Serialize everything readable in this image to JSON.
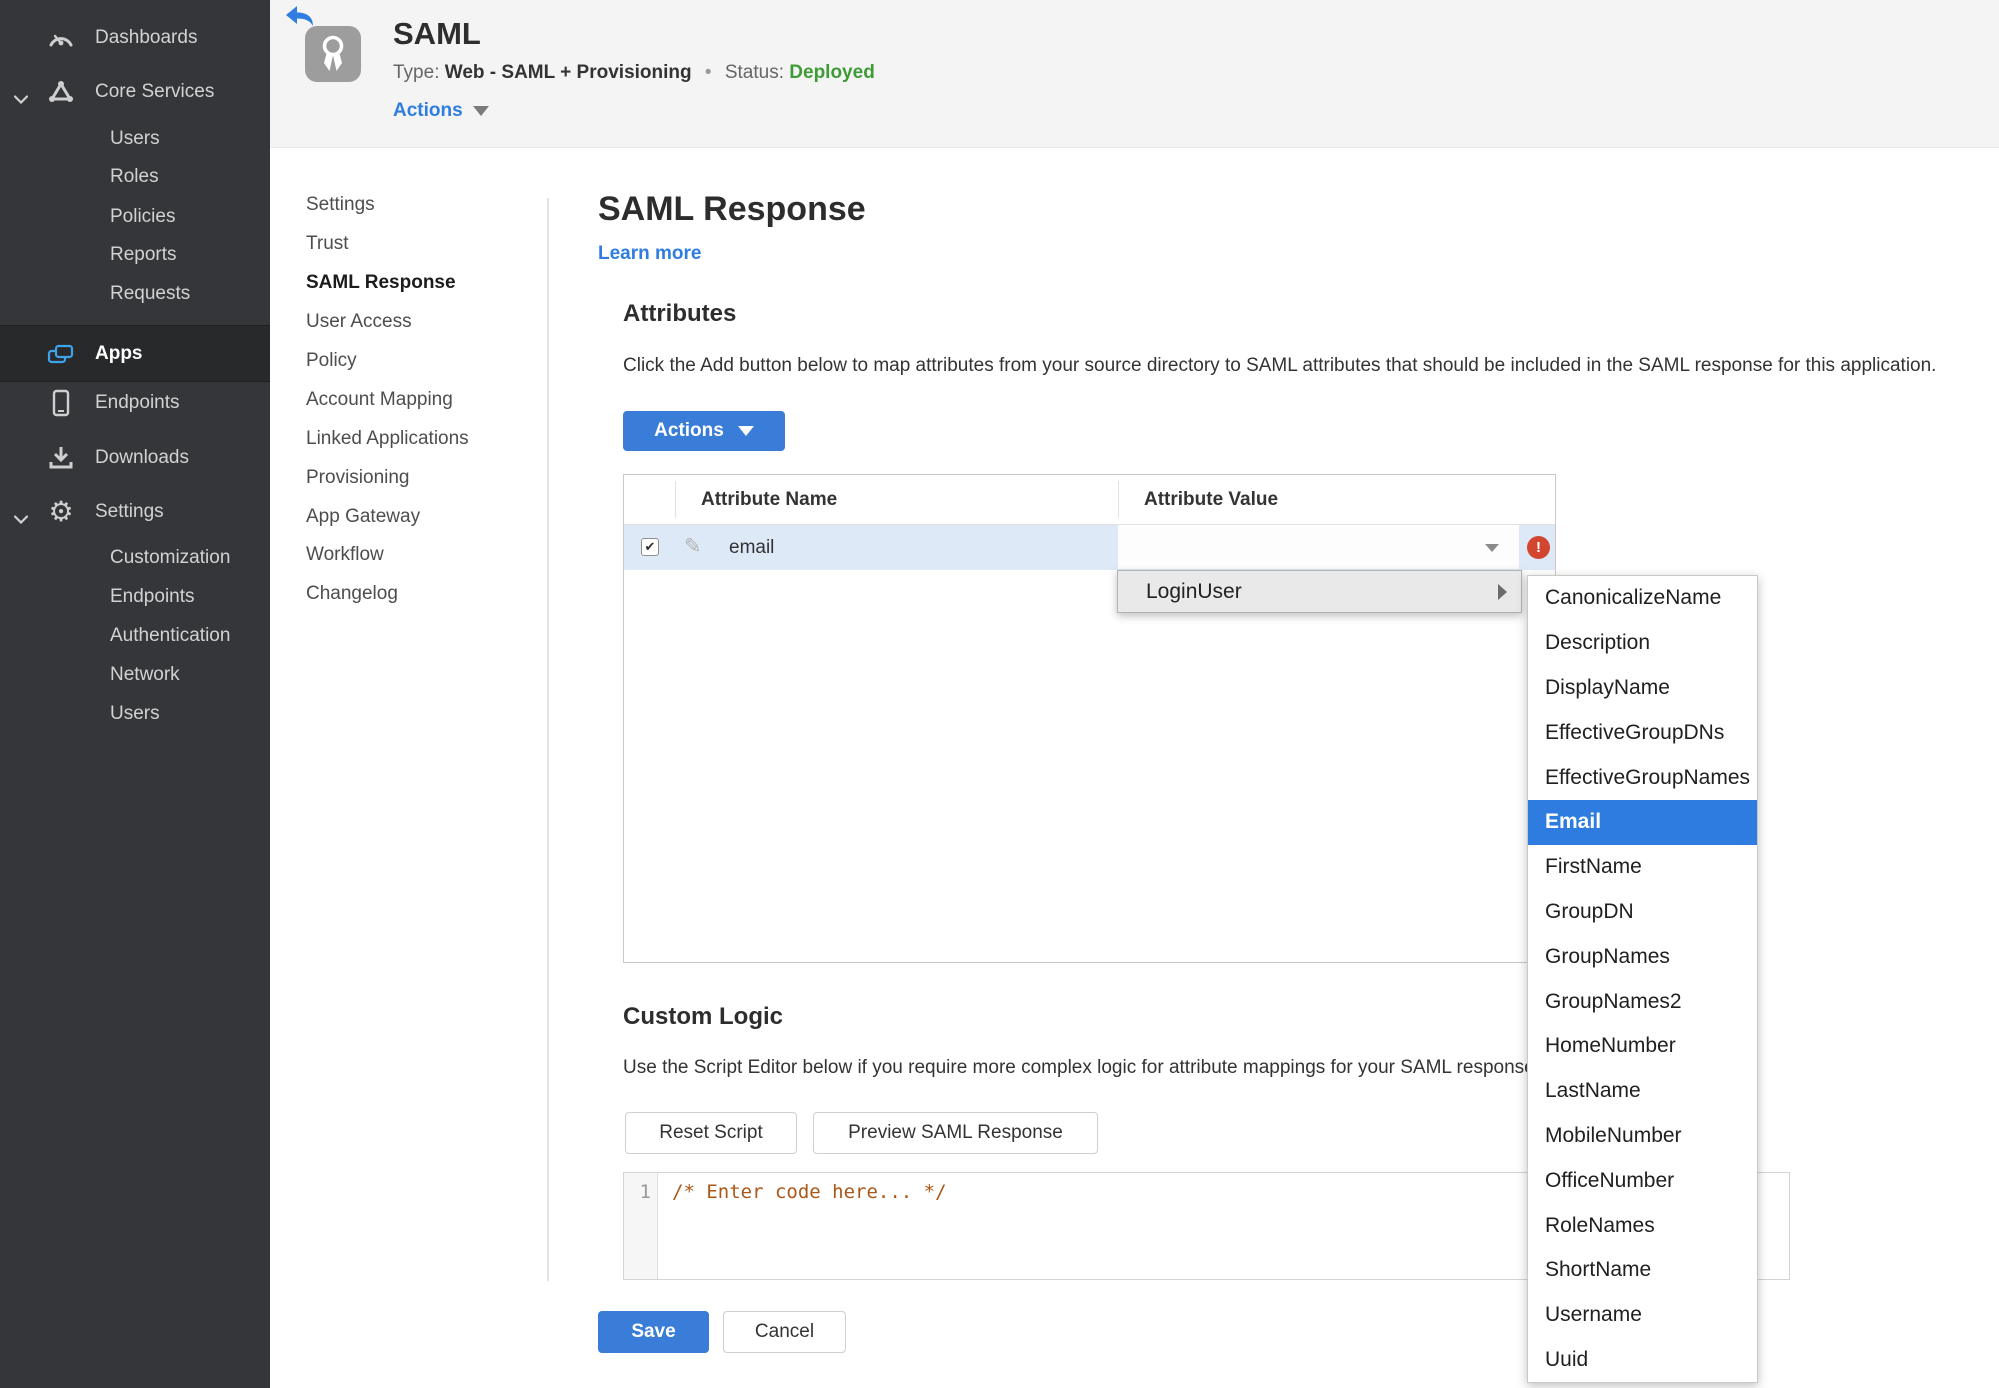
{
  "colors": {
    "accent_blue": "#2f7de1",
    "button_blue": "#3a7dd8",
    "status_green": "#3e9b35",
    "error_red": "#d2462f",
    "selection_blue": "#2e7ce0",
    "row_highlight": "#dde9f7",
    "sidebar_bg": "#343639"
  },
  "sidebar": {
    "items": [
      {
        "label": "Dashboards",
        "icon": "gauge-icon"
      },
      {
        "label": "Core Services",
        "icon": "core-services-icon",
        "expanded": true
      },
      {
        "label": "Users"
      },
      {
        "label": "Roles"
      },
      {
        "label": "Policies"
      },
      {
        "label": "Reports"
      },
      {
        "label": "Requests"
      },
      {
        "label": "Apps",
        "icon": "apps-icon",
        "selected": true
      },
      {
        "label": "Endpoints",
        "icon": "mobile-icon"
      },
      {
        "label": "Downloads",
        "icon": "download-icon"
      },
      {
        "label": "Settings",
        "icon": "gear-icon",
        "expanded": true
      },
      {
        "label": "Customization"
      },
      {
        "label": "Endpoints"
      },
      {
        "label": "Authentication"
      },
      {
        "label": "Network"
      },
      {
        "label": "Users"
      }
    ]
  },
  "header": {
    "title": "SAML",
    "type_label": "Type:",
    "type_value": "Web - SAML + Provisioning",
    "separator": "•",
    "status_label": "Status:",
    "status_value": "Deployed",
    "actions_label": "Actions"
  },
  "subnav": {
    "items": [
      {
        "label": "Settings"
      },
      {
        "label": "Trust"
      },
      {
        "label": "SAML Response",
        "active": true
      },
      {
        "label": "User Access"
      },
      {
        "label": "Policy"
      },
      {
        "label": "Account Mapping"
      },
      {
        "label": "Linked Applications"
      },
      {
        "label": "Provisioning"
      },
      {
        "label": "App Gateway"
      },
      {
        "label": "Workflow"
      },
      {
        "label": "Changelog"
      }
    ]
  },
  "main": {
    "title": "SAML Response",
    "learn_more": "Learn more",
    "attributes": {
      "heading": "Attributes",
      "description": "Click the Add button below to map attributes from your source directory to SAML attributes that should be included in the SAML response for this application.",
      "actions_button": "Actions",
      "table": {
        "columns": [
          "Attribute Name",
          "Attribute Value"
        ],
        "rows": [
          {
            "name": "email",
            "checked": true,
            "value": "",
            "error": true
          }
        ]
      }
    },
    "value_menu": {
      "parent": "LoginUser",
      "items": [
        {
          "label": "CanonicalizeName"
        },
        {
          "label": "Description"
        },
        {
          "label": "DisplayName"
        },
        {
          "label": "EffectiveGroupDNs"
        },
        {
          "label": "EffectiveGroupNames"
        },
        {
          "label": "Email",
          "selected": true
        },
        {
          "label": "FirstName"
        },
        {
          "label": "GroupDN"
        },
        {
          "label": "GroupNames"
        },
        {
          "label": "GroupNames2"
        },
        {
          "label": "HomeNumber"
        },
        {
          "label": "LastName"
        },
        {
          "label": "MobileNumber"
        },
        {
          "label": "OfficeNumber"
        },
        {
          "label": "RoleNames"
        },
        {
          "label": "ShortName"
        },
        {
          "label": "Username"
        },
        {
          "label": "Uuid"
        }
      ]
    },
    "custom_logic": {
      "heading": "Custom Logic",
      "description": "Use the Script Editor below if you require more complex logic for attribute mappings for your SAML response.",
      "reset_button": "Reset Script",
      "preview_button": "Preview SAML Response",
      "editor": {
        "line_number": "1",
        "code": "/* Enter code here... */"
      }
    },
    "save_button": "Save",
    "cancel_button": "Cancel"
  }
}
